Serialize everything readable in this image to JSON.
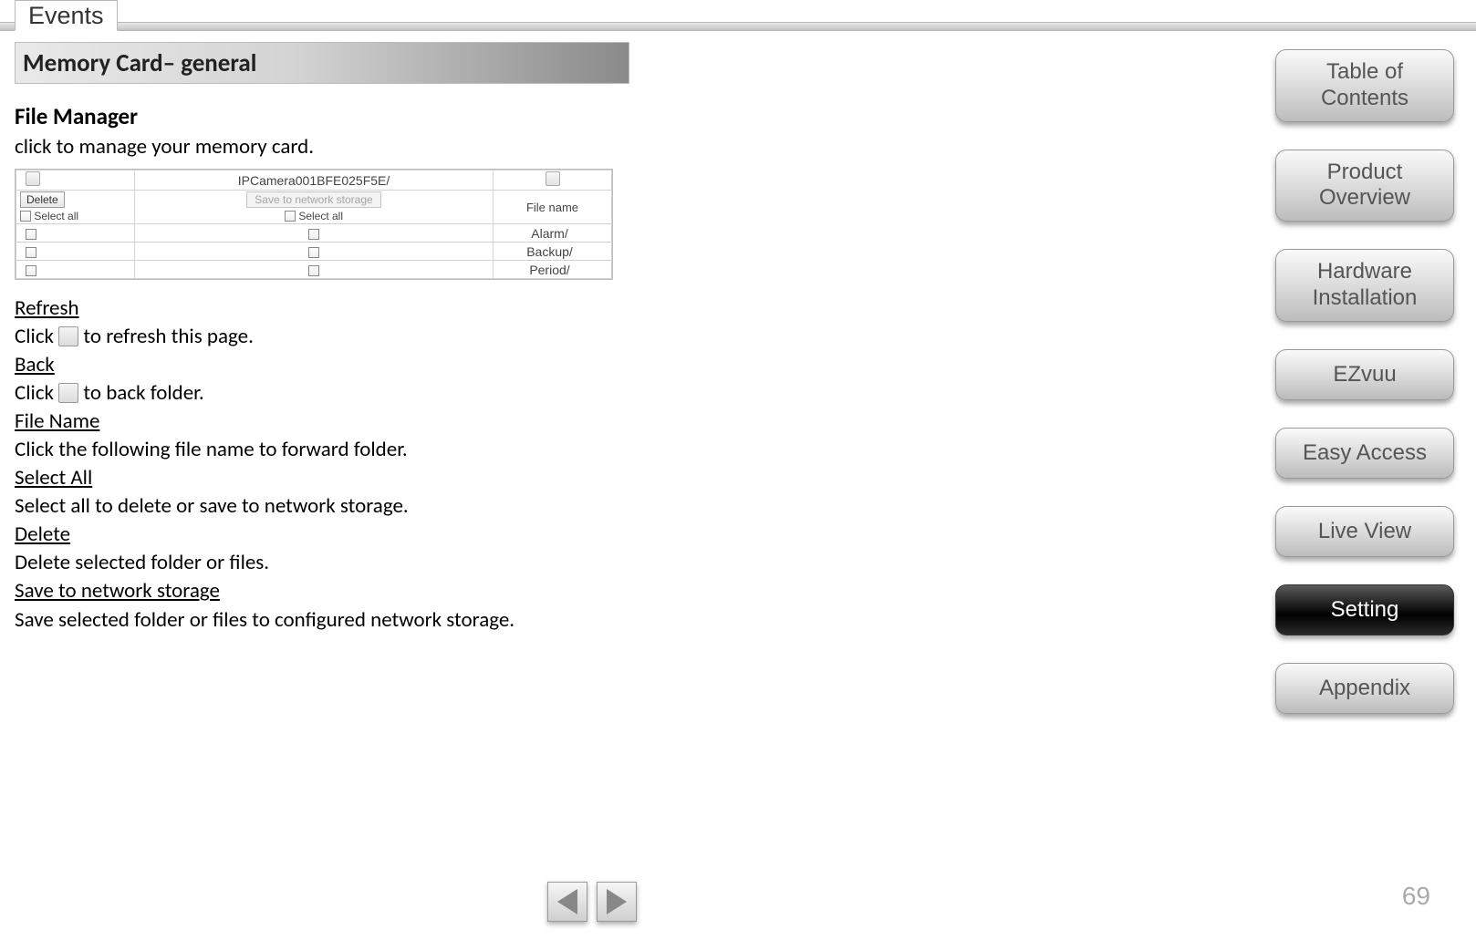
{
  "tab": {
    "label": "Events"
  },
  "section": {
    "title": "Memory Card– general"
  },
  "fileManager": {
    "heading": "File Manager",
    "blurb": "click to manage your memory card.",
    "path": "IPCamera001BFE025F5E/",
    "deleteBtn": "Delete",
    "saveBtn": "Save to network storage",
    "selectAll": "Select all",
    "fileNameHeader": "File name",
    "rows": [
      "Alarm/",
      "Backup/",
      "Period/"
    ]
  },
  "desc": {
    "refresh": {
      "h": "Refresh",
      "t1": "Click ",
      "t2": " to refresh this page."
    },
    "back": {
      "h": "Back",
      "t1": "Click ",
      "t2": " to back folder."
    },
    "filename": {
      "h": "File Name",
      "t": "Click the following file name to forward folder."
    },
    "selectall": {
      "h": "Select All",
      "t": "Select all to delete or save to network storage."
    },
    "delete": {
      "h": "Delete",
      "t": "Delete selected folder or files."
    },
    "save": {
      "h": "Save to network storage",
      "t": "Save selected folder or files to configured network storage."
    }
  },
  "nav": {
    "toc": "Table of Contents",
    "product": "Product Overview",
    "hardware": "Hardware Installation",
    "ezvuu": "EZvuu",
    "easy": "Easy Access",
    "live": "Live View",
    "setting": "Setting",
    "appendix": "Appendix"
  },
  "page": {
    "number": "69"
  }
}
